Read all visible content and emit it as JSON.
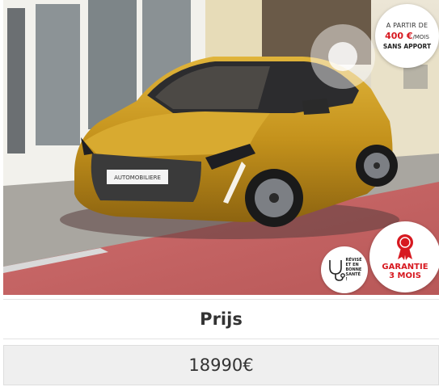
{
  "listing": {
    "photo_alt": "Peugeot 208",
    "dealer_plate": "AUTOMOBILIERE",
    "price_badge": {
      "line1": "A PARTIR DE",
      "amount": "400 €",
      "unit": "/MOIS",
      "line3": "SANS APPORT"
    },
    "revise_badge": {
      "text": "RÉVISÉ ET EN BONNE SANTÉ !",
      "icon": "stethoscope-icon"
    },
    "garantie_badge": {
      "line1": "GARANTIE",
      "line2": "3 MOIS",
      "icon": "award-ribbon-icon"
    },
    "price_label": "Prijs",
    "price_value": "18990€"
  },
  "colors": {
    "accent_red": "#d71920",
    "car_body": "#c89a1e",
    "table_alt_row": "#efefef"
  }
}
